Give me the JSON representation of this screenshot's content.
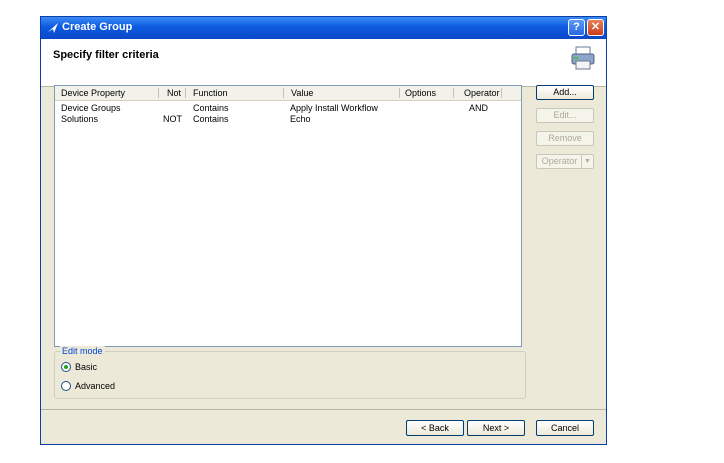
{
  "window": {
    "title": "Create Group",
    "help_label": "?",
    "close_label": "✕"
  },
  "header": {
    "title": "Specify filter criteria"
  },
  "table": {
    "columns": [
      "Device Property",
      "Not",
      "Function",
      "Value",
      "Options",
      "Operator"
    ],
    "rows": [
      {
        "device_property": "Device Groups",
        "not": "",
        "function": "Contains",
        "value": "Apply Install Workflow",
        "options": "",
        "operator": "AND"
      },
      {
        "device_property": "Solutions",
        "not": "NOT",
        "function": "Contains",
        "value": "Echo",
        "options": "",
        "operator": ""
      }
    ]
  },
  "side_buttons": {
    "add": "Add...",
    "edit": "Edit...",
    "remove": "Remove",
    "operator": "Operator"
  },
  "edit_mode": {
    "legend": "Edit mode",
    "basic": "Basic",
    "advanced": "Advanced",
    "selected": "Basic"
  },
  "footer": {
    "back": "< Back",
    "next": "Next >",
    "cancel": "Cancel"
  },
  "icons": {
    "title": "arrow-app-icon",
    "header": "printer-group-icon"
  },
  "colors": {
    "titlebar": "#0d5ae0",
    "dialog_bg": "#ece9d8",
    "radio_selected": "#21a121",
    "legend_text": "#0046d5"
  }
}
